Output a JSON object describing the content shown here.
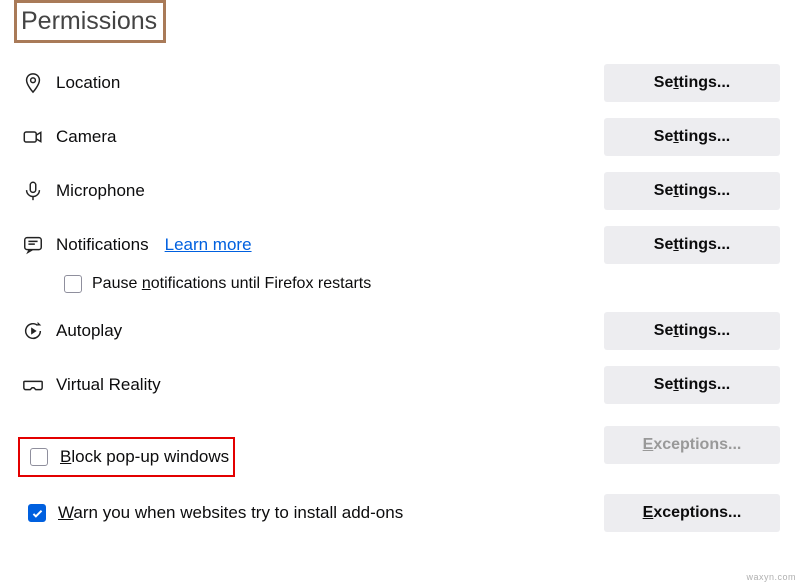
{
  "section_title": "Permissions",
  "perms": {
    "location": {
      "label": "Location",
      "btn": "Settings..."
    },
    "camera": {
      "label": "Camera",
      "btn": "Settings..."
    },
    "microphone": {
      "label": "Microphone",
      "btn": "Settings..."
    },
    "notifications": {
      "label": "Notifications",
      "learn_more": "Learn more",
      "btn": "Settings..."
    },
    "pause_notifications_label_pre": "Pause ",
    "pause_notifications_u": "n",
    "pause_notifications_label_post": "otifications until Firefox restarts",
    "autoplay": {
      "label": "Autoplay",
      "btn": "Settings..."
    },
    "vr": {
      "label": "Virtual Reality",
      "btn": "Settings..."
    }
  },
  "block_popups": {
    "u": "B",
    "rest": "lock pop-up windows",
    "btn_u": "E",
    "btn_rest": "xceptions..."
  },
  "warn_addons": {
    "u": "W",
    "rest": "arn you when websites try to install add-ons",
    "btn_u": "E",
    "btn_rest": "xceptions..."
  },
  "settings_u_letter": "t",
  "watermark": "waxyn.com"
}
